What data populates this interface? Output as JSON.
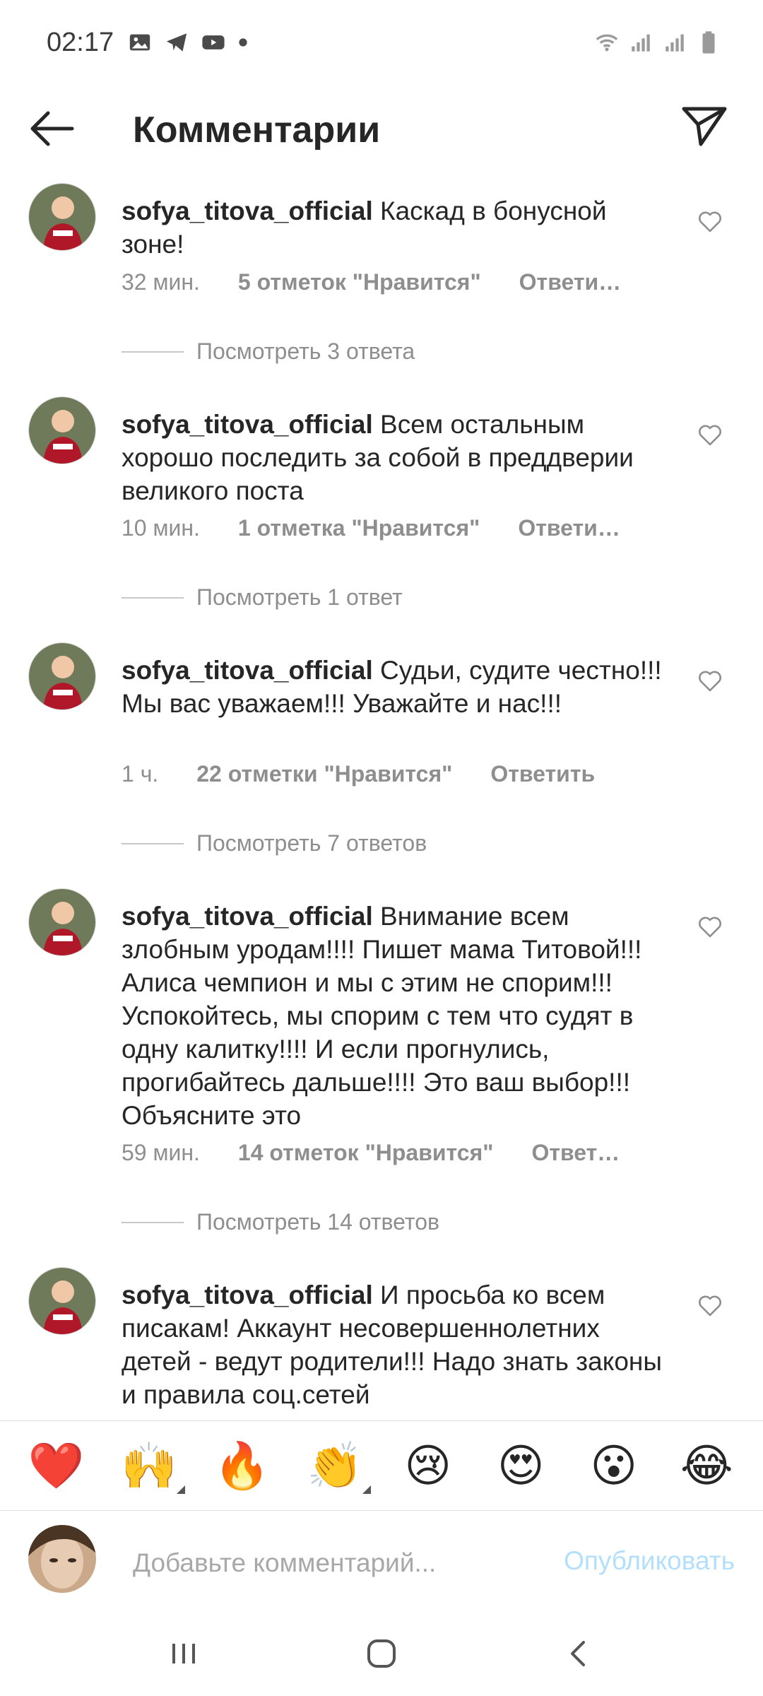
{
  "status_bar": {
    "time": "02:17",
    "left_icons": [
      "gallery-icon",
      "telegram-icon",
      "youtube-icon",
      "dot-icon"
    ],
    "right_icons": [
      "wifi-icon",
      "signal-icon",
      "signal-icon-2",
      "battery-icon"
    ]
  },
  "header": {
    "title": "Комментарии"
  },
  "comments": [
    {
      "username": "sofya_titova_official",
      "text": "Каскад в бонусной зоне!",
      "time": "32 мин.",
      "likes": "5 отметок \"Нравится\"",
      "reply": "Ответи…",
      "view_replies": "Посмотреть 3 ответа"
    },
    {
      "username": "sofya_titova_official",
      "text": "Всем остальным хорошо последить за собой в преддверии великого поста",
      "time": "10 мин.",
      "likes": "1 отметка \"Нравится\"",
      "reply": "Ответи…",
      "view_replies": "Посмотреть 1 ответ"
    },
    {
      "username": "sofya_titova_official",
      "text": "Судьи, судите честно!!! Мы вас уважаем!!! Уважайте и нас!!!",
      "time": "1 ч.",
      "likes": "22 отметки \"Нравится\"",
      "reply": "Ответить",
      "view_replies": "Посмотреть 7 ответов"
    },
    {
      "username": "sofya_titova_official",
      "text": "Внимание всем злобным уродам!!!! Пишет мама Титовой!!! Алиса чемпион и мы с этим не спорим!!! Успокойтесь, мы спорим с тем что судят в одну калитку!!!! И если прогнулись, прогибайтесь дальше!!!! Это ваш выбор!!! Объясните это",
      "time": "59 мин.",
      "likes": "14 отметок \"Нравится\"",
      "reply": "Ответ…",
      "view_replies": "Посмотреть 14 ответов"
    },
    {
      "username": "sofya_titova_official",
      "text": "И просьба ко всем писакам! Аккаунт несовершеннолетних детей - ведут родители!!! Надо знать законы и правила соц.сетей",
      "time": "",
      "likes": "",
      "reply": "",
      "view_replies": ""
    }
  ],
  "emoji_bar": {
    "emojis": [
      "❤️",
      "🙌",
      "🔥",
      "👏",
      "😢",
      "😍",
      "😮",
      "😂"
    ]
  },
  "compose": {
    "placeholder": "Добавьте комментарий...",
    "publish_label": "Опубликовать",
    "publish_color": "#b2dffc"
  },
  "nav_bar": {
    "buttons": [
      "recent-apps-icon",
      "home-icon",
      "back-nav-icon"
    ]
  }
}
